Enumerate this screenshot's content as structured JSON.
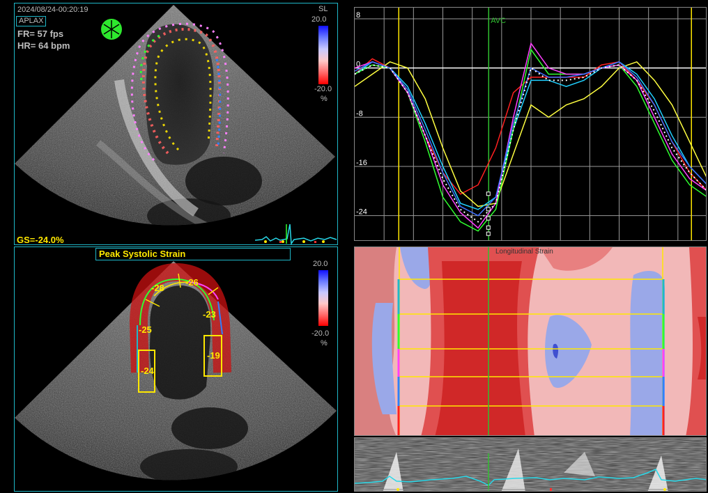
{
  "top_left": {
    "timestamp": "2024/08/24-00:20:19",
    "view": "APLAX",
    "fr": "FR= 57 fps",
    "hr": "HR= 64 bpm",
    "scale_title": "SL",
    "scale_max": "20.0",
    "scale_min": "-20.0",
    "scale_unit": "%",
    "gs": "GS=-24.0%"
  },
  "bottom_left": {
    "title": "Peak Systolic Strain",
    "scale_max": "20.0",
    "scale_min": "-20.0",
    "scale_unit": "%",
    "segments": [
      "-28",
      "-26",
      "-25",
      "-23",
      "-24",
      "-19"
    ]
  },
  "m_mode": {
    "title": "Longitudinal Strain"
  },
  "colors": {
    "panel_border": "#1fb8c9",
    "scale_positive": "#3333ff",
    "scale_negative": "#ff0000",
    "text_yellow": "#ffe800"
  },
  "chart_data": {
    "type": "line",
    "title": "",
    "xlabel": "",
    "ylabel": "",
    "ylim": [
      -28,
      8
    ],
    "yticks": [
      8,
      0,
      -8,
      -16,
      -24
    ],
    "marker_label": "AVC",
    "x": [
      0,
      0.05,
      0.1,
      0.15,
      0.2,
      0.25,
      0.3,
      0.35,
      0.4,
      0.45,
      0.5,
      0.55,
      0.6,
      0.65,
      0.7,
      0.75,
      0.8,
      0.85,
      0.9,
      0.95,
      1.0
    ],
    "series": [
      {
        "color": "#ff2020",
        "values": [
          -1,
          1.5,
          0,
          -4,
          -11,
          -17,
          -20.5,
          -19,
          -13,
          -4,
          -1.5,
          -1.5,
          -1.5,
          -1.5,
          0.5,
          1,
          -2,
          -6,
          -12,
          -17,
          -20
        ]
      },
      {
        "color": "#ffff40",
        "values": [
          -3,
          -1,
          1,
          0,
          -5,
          -13,
          -20,
          -22.5,
          -22,
          -14,
          -6,
          -8,
          -6,
          -5,
          -3,
          0,
          1,
          -2,
          -6,
          -12,
          -18
        ]
      },
      {
        "color": "#20d0ff",
        "values": [
          -1,
          1,
          0,
          -3,
          -9,
          -16,
          -22,
          -23,
          -21,
          -10,
          -2,
          -2,
          -3,
          -2,
          0,
          1,
          -1,
          -5,
          -11,
          -16,
          -19
        ]
      },
      {
        "color": "#30ff30",
        "values": [
          -1,
          0.5,
          0,
          -4,
          -12,
          -21,
          -25,
          -26.5,
          -23,
          -10,
          3,
          -1,
          -1,
          -1,
          0,
          0.5,
          -3,
          -9,
          -15,
          -19,
          -21
        ]
      },
      {
        "color": "#ff40ff",
        "values": [
          0,
          1,
          0,
          -4,
          -11,
          -19,
          -23.5,
          -26,
          -22,
          -8,
          4,
          0,
          -1,
          -1,
          0,
          0.5,
          -2,
          -8,
          -14,
          -18,
          -20
        ]
      },
      {
        "color": "#4070ff",
        "values": [
          -0.5,
          1,
          0,
          -3.5,
          -10,
          -17,
          -22.5,
          -24,
          -21,
          -9,
          0,
          -1.5,
          -1.5,
          -1,
          0,
          1,
          -1.5,
          -6,
          -12,
          -16,
          -19
        ]
      },
      {
        "color": "#ffffff",
        "values": [
          -1,
          0.5,
          0,
          -4,
          -11,
          -18,
          -23,
          -25,
          -22,
          -10,
          0,
          -2,
          -2,
          -1.5,
          0,
          0.5,
          -2,
          -7,
          -13,
          -17,
          -20
        ]
      }
    ]
  }
}
